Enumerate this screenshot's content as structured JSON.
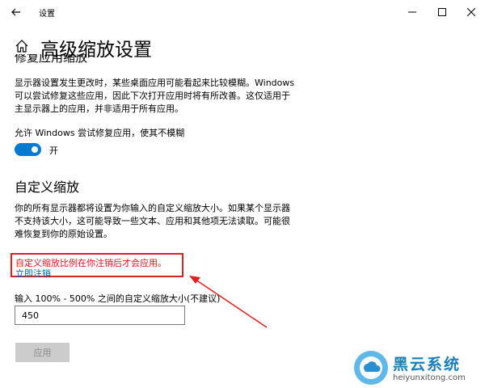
{
  "window": {
    "title": "设置",
    "back_icon": "back-arrow-icon",
    "minimize_icon": "minimize-icon",
    "maximize_icon": "maximize-icon",
    "close_icon": "close-icon"
  },
  "header": {
    "home_icon": "home-icon",
    "title": "高级缩放设置"
  },
  "fix_apps": {
    "heading_partial": "修复应用缩放",
    "description": "显示器设置发生更改时，某些桌面应用可能看起来比较模糊。Windows 可以尝试修复这些应用，因此下次打开应用时将有所改善。这仅适用于主显示器上的应用，并非适用于所有应用。",
    "toggle_label": "允许 Windows 尝试修复应用，使其不模糊",
    "toggle_on": true,
    "toggle_state_text": "开",
    "accent_color": "#0078d7"
  },
  "custom_scaling": {
    "heading": "自定义缩放",
    "description": "你的所有显示器都将设置为你输入的自定义缩放大小。如果某个显示器不支持该大小，这可能导致一些文本、应用和其他项无法读取。可能很难恢复到你的原始设置。",
    "warning": "自定义缩放比例在你注销后才会应用。",
    "warning_color": "#e81123",
    "signout_link": "立即注销",
    "input_label": "输入 100% - 500% 之间的自定义缩放大小(不建议)",
    "input_value": "450",
    "apply_button": "应用"
  },
  "watermark": {
    "logo_icon": "cloud-logo-icon",
    "name": "黑云系统",
    "url": "heiyunxitong.com"
  }
}
